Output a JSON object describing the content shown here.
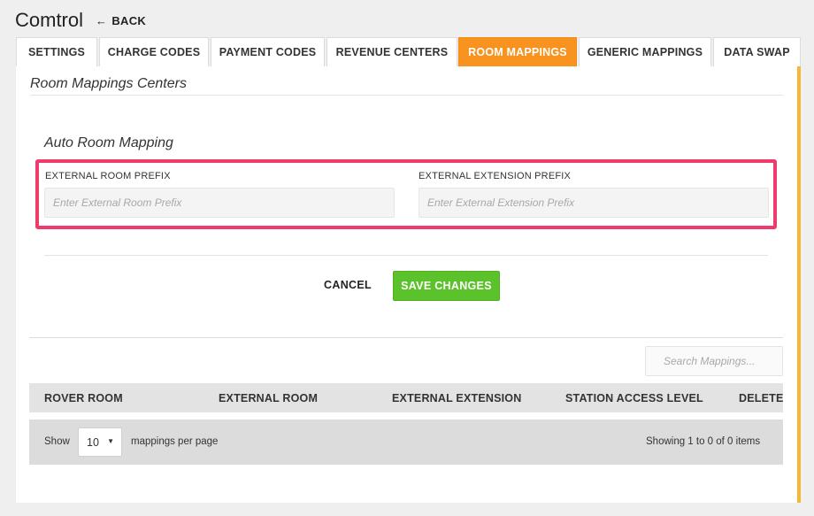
{
  "app": {
    "title": "Comtrol",
    "back_label": "BACK"
  },
  "tabs": [
    {
      "label": "SETTINGS",
      "active": false
    },
    {
      "label": "CHARGE CODES",
      "active": false
    },
    {
      "label": "PAYMENT CODES",
      "active": false
    },
    {
      "label": "REVENUE CENTERS",
      "active": false
    },
    {
      "label": "ROOM MAPPINGS",
      "active": true
    },
    {
      "label": "GENERIC MAPPINGS",
      "active": false
    },
    {
      "label": "DATA SWAP",
      "active": false
    }
  ],
  "section": {
    "title": "Room Mappings Centers"
  },
  "auto_mapping": {
    "title": "Auto Room Mapping",
    "room_prefix_label": "EXTERNAL ROOM PREFIX",
    "room_prefix_placeholder": "Enter External Room Prefix",
    "room_prefix_value": "",
    "extension_prefix_label": "EXTERNAL EXTENSION PREFIX",
    "extension_prefix_placeholder": "Enter External Extension Prefix",
    "extension_prefix_value": ""
  },
  "actions": {
    "cancel_label": "CANCEL",
    "save_label": "SAVE CHANGES"
  },
  "search": {
    "placeholder": "Search Mappings..."
  },
  "table": {
    "columns": [
      "ROVER ROOM",
      "EXTERNAL ROOM",
      "EXTERNAL EXTENSION",
      "STATION ACCESS LEVEL",
      "DELETE"
    ],
    "rows": []
  },
  "pagination": {
    "show_label": "Show",
    "per_page_value": "10",
    "per_page_suffix": "mappings per page",
    "summary": "Showing 1 to 0 of 0 items"
  },
  "colors": {
    "active_tab": "#f7931e",
    "save_button": "#5cc22c",
    "highlight": "#ef3b6b"
  }
}
